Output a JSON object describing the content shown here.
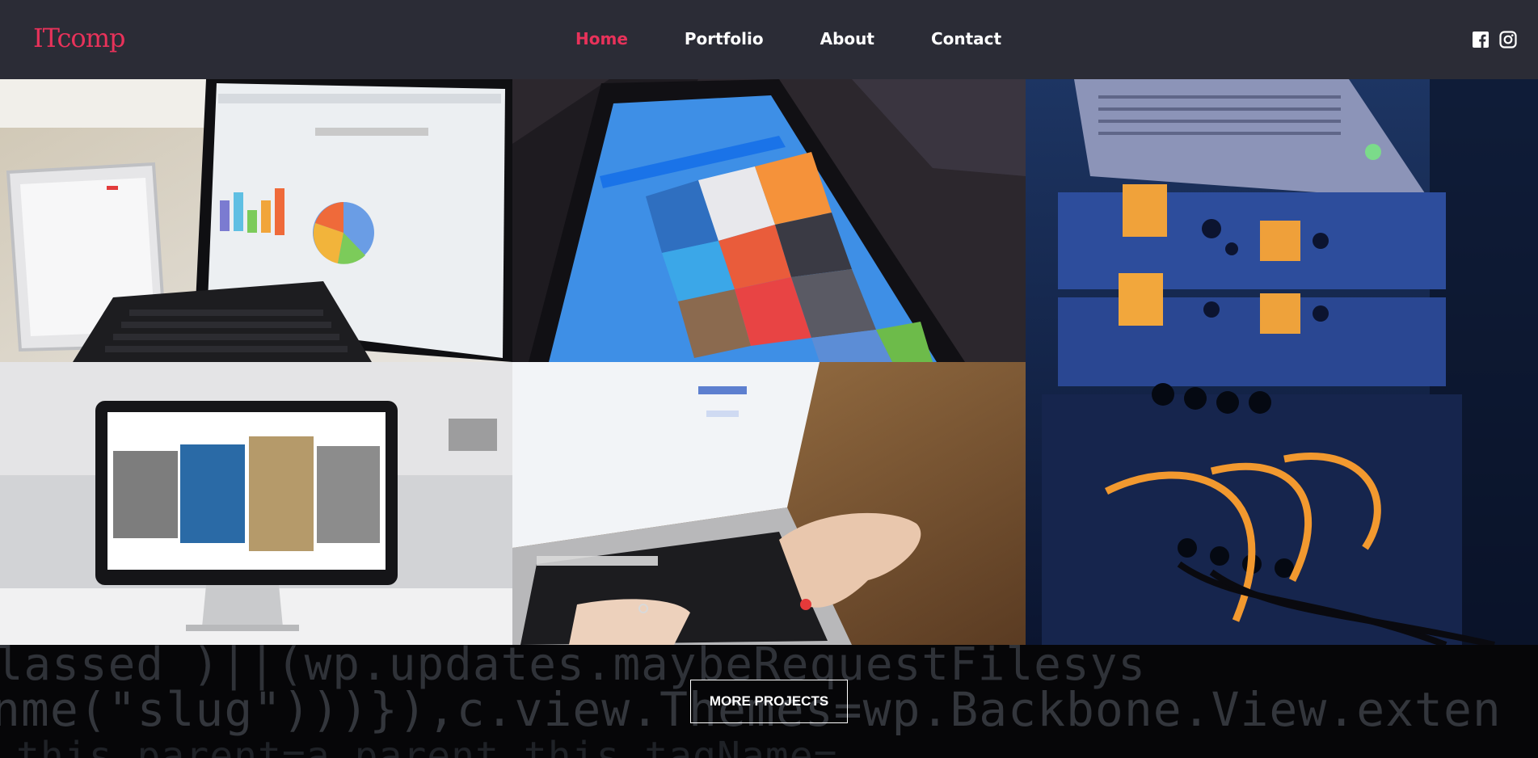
{
  "brand": {
    "logo": "ITcomp",
    "accent": "#e8325a"
  },
  "nav": {
    "items": [
      {
        "label": "Home",
        "active": true
      },
      {
        "label": "Portfolio",
        "active": false
      },
      {
        "label": "About",
        "active": false
      },
      {
        "label": "Contact",
        "active": false
      }
    ]
  },
  "social": {
    "icons": [
      "facebook-icon",
      "instagram-icon"
    ]
  },
  "portfolio": {
    "tiles": [
      {
        "name": "laptop-tablet-charts-photo"
      },
      {
        "name": "tablet-collections-app-photo"
      },
      {
        "name": "server-rack-cables-photo"
      },
      {
        "name": "desktop-monitor-gallery-photo"
      },
      {
        "name": "hands-typing-laptop-photo"
      }
    ]
  },
  "footer": {
    "more_label": "MORE PROJECTS",
    "code_text_1": "  classed )||(wp.updates.maybeRequestFilesys",
    "code_text_2": "nme(\"slug\")))}),c.view.Themes=wp.Backbone.View.exten",
    "code_text_3": "   this.parent=a.parent,this.tagName="
  }
}
